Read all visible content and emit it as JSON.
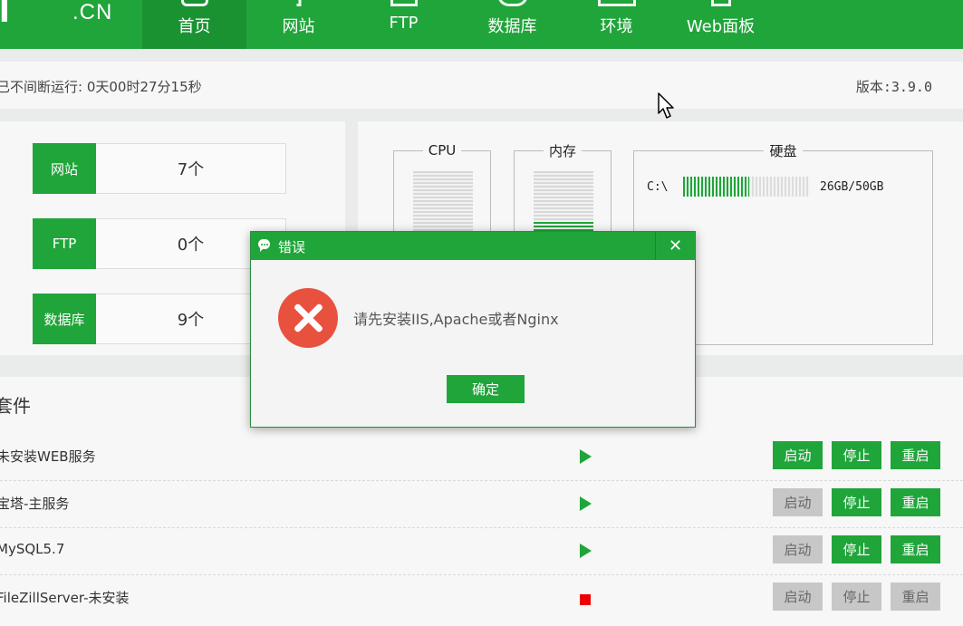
{
  "logo": {
    "mark": "T",
    "suffix": ".CN"
  },
  "nav": [
    {
      "label": "首页",
      "active": true
    },
    {
      "label": "网站"
    },
    {
      "label": "FTP"
    },
    {
      "label": "数据库"
    },
    {
      "label": "环境"
    },
    {
      "label": "Web面板"
    }
  ],
  "status": {
    "uptime": "已不间断运行: 0天00时27分15秒",
    "version": "版本:3.9.0"
  },
  "stats": [
    {
      "label": "网站",
      "value": "7个"
    },
    {
      "label": "FTP",
      "value": "0个"
    },
    {
      "label": "数据库",
      "value": "9个"
    }
  ],
  "resources": {
    "cpu": {
      "label": "CPU",
      "usage": 0
    },
    "memory": {
      "label": "内存",
      "usage": 0.2
    },
    "disk": {
      "label": "硬盘",
      "drive": "C:\\",
      "usage_text": "26GB/50GB",
      "usage": 0.52
    }
  },
  "software": {
    "title": "套件",
    "rows": [
      {
        "name": "未安装WEB服务",
        "state": "play",
        "buttons": [
          {
            "label": "启动",
            "enabled": true
          },
          {
            "label": "停止",
            "enabled": true
          },
          {
            "label": "重启",
            "enabled": true
          }
        ]
      },
      {
        "name": "宝塔-主服务",
        "state": "play",
        "buttons": [
          {
            "label": "启动",
            "enabled": false
          },
          {
            "label": "停止",
            "enabled": true
          },
          {
            "label": "重启",
            "enabled": true
          }
        ]
      },
      {
        "name": "MySQL5.7",
        "state": "play",
        "buttons": [
          {
            "label": "启动",
            "enabled": false
          },
          {
            "label": "停止",
            "enabled": true
          },
          {
            "label": "重启",
            "enabled": true
          }
        ]
      },
      {
        "name": "FileZillServer-未安装",
        "state": "stop",
        "buttons": [
          {
            "label": "启动",
            "enabled": false
          },
          {
            "label": "停止",
            "enabled": false
          },
          {
            "label": "重启",
            "enabled": false
          }
        ]
      }
    ]
  },
  "dialog": {
    "title": "错误",
    "message": "请先安装IIS,Apache或者Nginx",
    "ok_label": "确定",
    "close_glyph": "✕"
  },
  "icons": {
    "dialog_title": "chat-icon",
    "dialog_error": "error-x-icon",
    "close": "close-icon",
    "cursor": "mouse-pointer-icon"
  },
  "colors": {
    "brand": "#20a53a",
    "error": "#e9513f",
    "stopped": "#ee0000",
    "disabled": "#c7c7c7"
  }
}
